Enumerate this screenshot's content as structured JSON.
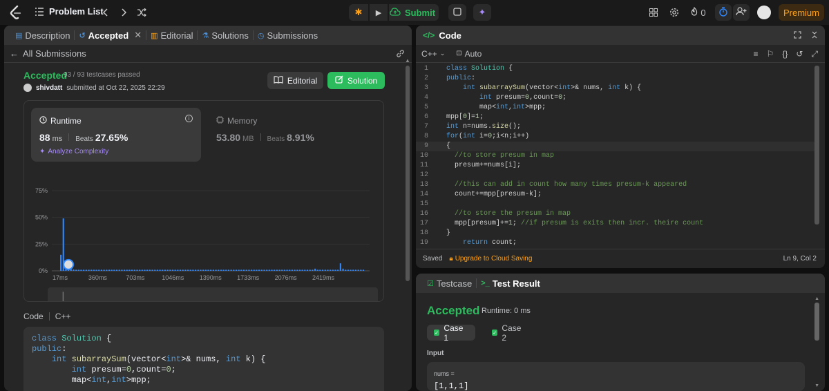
{
  "topbar": {
    "problem_list": "Problem List",
    "submit": "Submit",
    "streak": "0",
    "premium": "Premium"
  },
  "left_tabs": {
    "description": "Description",
    "accepted": "Accepted",
    "editorial": "Editorial",
    "solutions": "Solutions",
    "submissions": "Submissions"
  },
  "subbar": {
    "all_submissions": "All Submissions"
  },
  "submission": {
    "status": "Accepted",
    "testcases": "93 / 93 testcases passed",
    "user": "shivdatt",
    "submitted_text": "submitted at Oct 22, 2025 22:29",
    "editorial_btn": "Editorial",
    "solution_btn": "Solution"
  },
  "runtime": {
    "title": "Runtime",
    "value": "88",
    "unit": "ms",
    "beats_label": "Beats",
    "beats_value": "27.65%",
    "analyze": "Analyze Complexity"
  },
  "memory": {
    "title": "Memory",
    "value": "53.80",
    "unit": "MB",
    "beats_label": "Beats",
    "beats_value": "8.91%"
  },
  "chart_data": {
    "type": "bar",
    "yticks": [
      "75%",
      "50%",
      "25%",
      "0%"
    ],
    "ylim": [
      0,
      75
    ],
    "xticks": [
      "17ms",
      "360ms",
      "703ms",
      "1046ms",
      "1390ms",
      "1733ms",
      "2076ms",
      "2419ms"
    ],
    "x_start_ms": 17,
    "x_step_ms": 343,
    "bar_values": [
      15,
      49,
      9,
      2,
      1.5,
      1.2,
      1,
      1,
      1,
      1,
      1,
      1,
      1,
      1,
      1,
      1,
      1,
      1,
      1,
      1,
      1,
      1,
      1,
      1,
      1,
      1,
      1,
      1,
      1,
      1,
      1,
      1,
      1,
      1,
      1,
      1,
      1,
      1,
      1,
      1,
      1,
      1,
      1,
      1,
      1,
      1,
      1,
      1,
      1,
      1,
      1,
      1,
      1,
      1,
      1,
      1,
      1,
      1,
      1,
      1,
      1,
      1,
      1,
      1,
      1,
      1,
      1,
      1,
      1,
      1,
      1,
      1,
      1,
      1,
      1,
      1,
      1,
      1,
      1,
      1,
      1,
      1,
      1,
      1,
      1,
      1,
      1,
      1,
      1,
      1,
      1,
      1,
      1,
      1,
      1,
      1,
      1,
      1,
      1,
      1,
      2,
      1,
      1,
      1,
      1,
      1,
      1,
      1,
      1,
      1,
      7,
      2,
      1,
      1,
      1,
      1,
      1,
      1,
      1,
      1
    ],
    "bar_color": "#2f88ff",
    "user_bar_index": 3
  },
  "code_section": {
    "label": "Code",
    "lang": "C++",
    "snippet": [
      "class Solution {",
      "public:",
      "    int subarraySum(vector<int>& nums, int k) {",
      "        int presum=0,count=0;",
      "        map<int,int>mpp;"
    ]
  },
  "editor": {
    "title": "Code",
    "lang": "C++",
    "mode": "Auto",
    "lines": [
      "class Solution {",
      "public:",
      "    int subarraySum(vector<int>& nums, int k) {",
      "        int presum=0,count=0;",
      "        map<int,int>mpp;",
      "mpp[0]=1;",
      "int n=nums.size();",
      "for(int i=0;i<n;i++)",
      "{",
      "  //to store presum in map",
      "  presum+=nums[i];",
      "",
      "  //this can add in count how many times presum-k appeared",
      "  count+=mpp[presum-k];",
      "",
      "  //to store the presum in map",
      "  mpp[presum]+=1; //if presum is exits then incr. theire count",
      "}",
      "    return count;"
    ],
    "saved": "Saved",
    "upgrade": "Upgrade to Cloud Saving",
    "cursor": "Ln 9, Col 2"
  },
  "result": {
    "tab_testcase": "Testcase",
    "tab_result": "Test Result",
    "status": "Accepted",
    "runtime": "Runtime: 0 ms",
    "case1": "Case 1",
    "case2": "Case 2",
    "input_label": "Input",
    "param_name": "nums =",
    "param_value": "[1,1,1]"
  }
}
